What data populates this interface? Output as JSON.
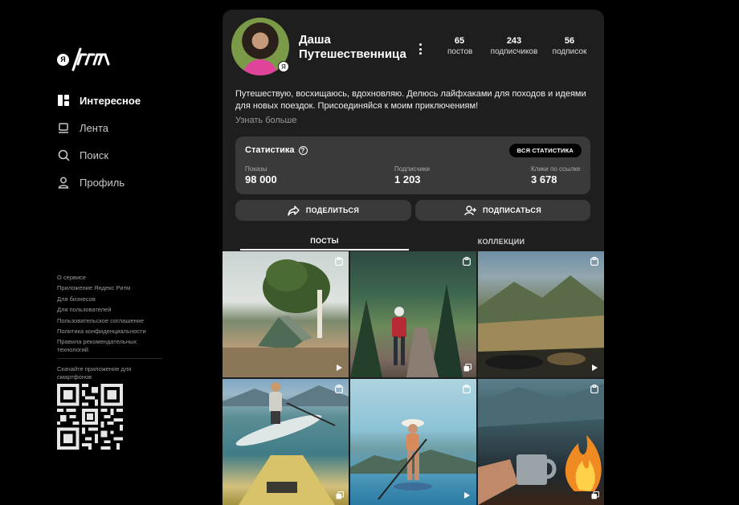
{
  "logo": {
    "mark": "Я",
    "wordmark": "РИТМ"
  },
  "nav": [
    {
      "label": "Интересное",
      "icon": "grid-icon",
      "active": true
    },
    {
      "label": "Лента",
      "icon": "feed-icon",
      "active": false
    },
    {
      "label": "Поиск",
      "icon": "search-icon",
      "active": false
    },
    {
      "label": "Профиль",
      "icon": "profile-icon",
      "active": false
    }
  ],
  "footer_links": [
    "О сервисе",
    "Приложение Яндекс Ритм",
    "Для бизнесов",
    "Для пользователей",
    "Пользовательское соглашение",
    "Политика конфиденциальности",
    "Правила рекомендательных технологий"
  ],
  "app_download": "Скачайте приложение для смартфонов",
  "profile": {
    "name": "Даша Путешественница",
    "badge": "Я",
    "stats": [
      {
        "value": "65",
        "label": "постов"
      },
      {
        "value": "243",
        "label": "подписчиков"
      },
      {
        "value": "56",
        "label": "подписок"
      }
    ],
    "bio": "Путешествую, восхищаюсь, вдохновляю. Делюсь лайфхаками для походов и идеями для новых поездок. Присоединяйся к моим приключениям!",
    "more_link": "Узнать больше"
  },
  "statistics": {
    "title": "Статистика",
    "all_button": "ВСЯ СТАТИСТИКА",
    "metrics": [
      {
        "label": "Показы",
        "value": "98 000"
      },
      {
        "label": "Подписчики",
        "value": "1 203"
      },
      {
        "label": "Клики по ссылке",
        "value": "3 678"
      }
    ]
  },
  "actions": {
    "share": "ПОДЕЛИТЬСЯ",
    "subscribe": "ПОДПИСАТЬСЯ"
  },
  "tabs": [
    {
      "label": "ПОСТЫ",
      "active": true
    },
    {
      "label": "КОЛЛЕКЦИИ",
      "active": false
    }
  ],
  "posts": [
    {
      "scene": "camping-tent",
      "type": "video"
    },
    {
      "scene": "hiking-trail",
      "type": "gallery"
    },
    {
      "scene": "mountain-view",
      "type": "video"
    },
    {
      "scene": "paddleboard-lake",
      "type": "gallery"
    },
    {
      "scene": "paddleboard-sea",
      "type": "video"
    },
    {
      "scene": "campfire-mug",
      "type": "gallery"
    }
  ],
  "colors": {
    "background": "#000000",
    "card": "#1e1e1e",
    "panel": "#3a3a3a",
    "accent_pink": "#e0439a"
  }
}
